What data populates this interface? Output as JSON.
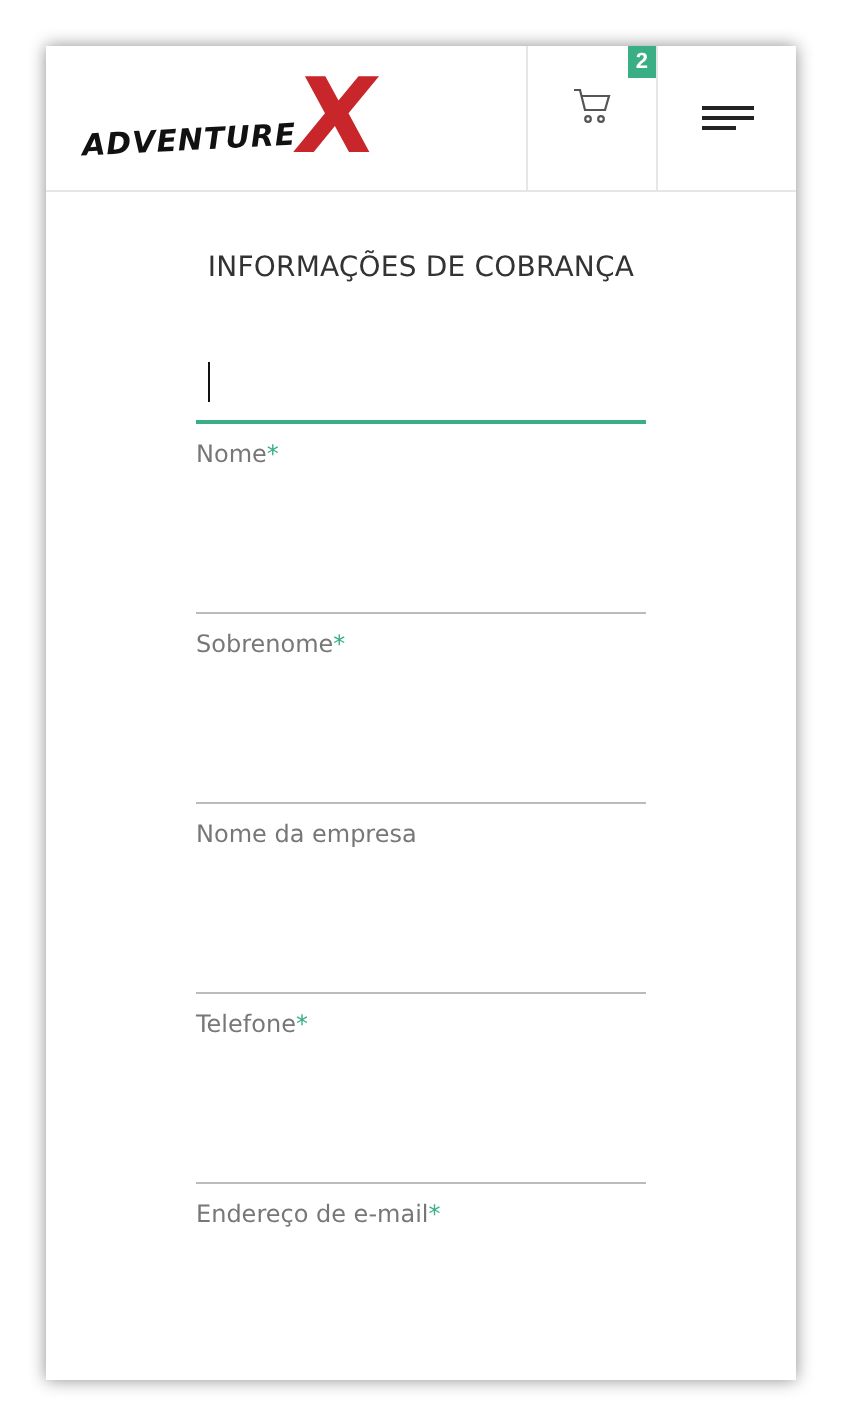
{
  "logo": {
    "text": "ADVENTURE",
    "mark": "X"
  },
  "cart": {
    "count": "2"
  },
  "title": "INFORMAÇÕES DE COBRANÇA",
  "required_mark": "*",
  "fields": [
    {
      "label": "Nome",
      "required": true,
      "focused": true
    },
    {
      "label": "Sobrenome",
      "required": true,
      "focused": false
    },
    {
      "label": "Nome da empresa",
      "required": false,
      "focused": false
    },
    {
      "label": "Telefone",
      "required": true,
      "focused": false
    },
    {
      "label": "Endereço de e-mail",
      "required": true,
      "focused": false
    }
  ]
}
